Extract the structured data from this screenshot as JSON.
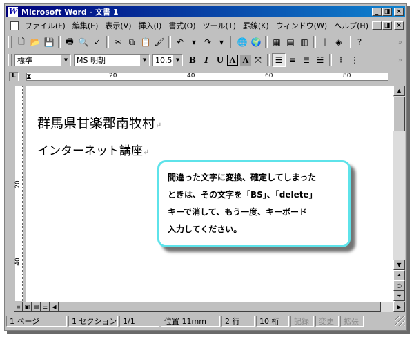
{
  "window": {
    "icon_letter": "W",
    "title": "Microsoft Word - 文書 1",
    "minimize": "_",
    "restore": "◨",
    "close": "×"
  },
  "menubar": {
    "items": [
      "ファイル(F)",
      "編集(E)",
      "表示(V)",
      "挿入(I)",
      "書式(O)",
      "ツール(T)",
      "罫線(K)",
      "ウィンドウ(W)",
      "ヘルプ(H)"
    ],
    "doc_min": "_",
    "doc_restore": "◨",
    "doc_close": "×"
  },
  "format_bar": {
    "style": "標準",
    "font": "MS 明朝",
    "size": "10.5",
    "bold": "B",
    "italic": "I",
    "underline": "U",
    "border_char": "A",
    "shade_char": "A"
  },
  "ruler": {
    "marks": [
      "20",
      "40",
      "60",
      "80"
    ],
    "vmarks": [
      "20",
      "40"
    ],
    "tab_selector": "L"
  },
  "document": {
    "line1": "群馬県甘楽郡南牧村",
    "line2": "インターネット講座",
    "para_mark": "↵"
  },
  "callout": {
    "lines": [
      "間違った文字に変換、確定してしまった",
      "ときは、その文字を「BS」、「delete」",
      "キーで消して、もう一度、キーボード",
      "入力してください。"
    ]
  },
  "status": {
    "page": "1 ページ",
    "section": "1 セクション",
    "pages": "1/1",
    "position": "位置 11mm",
    "line": "2 行",
    "column": "10 桁",
    "rec": "記録",
    "trk": "変更",
    "ext": "拡張"
  }
}
